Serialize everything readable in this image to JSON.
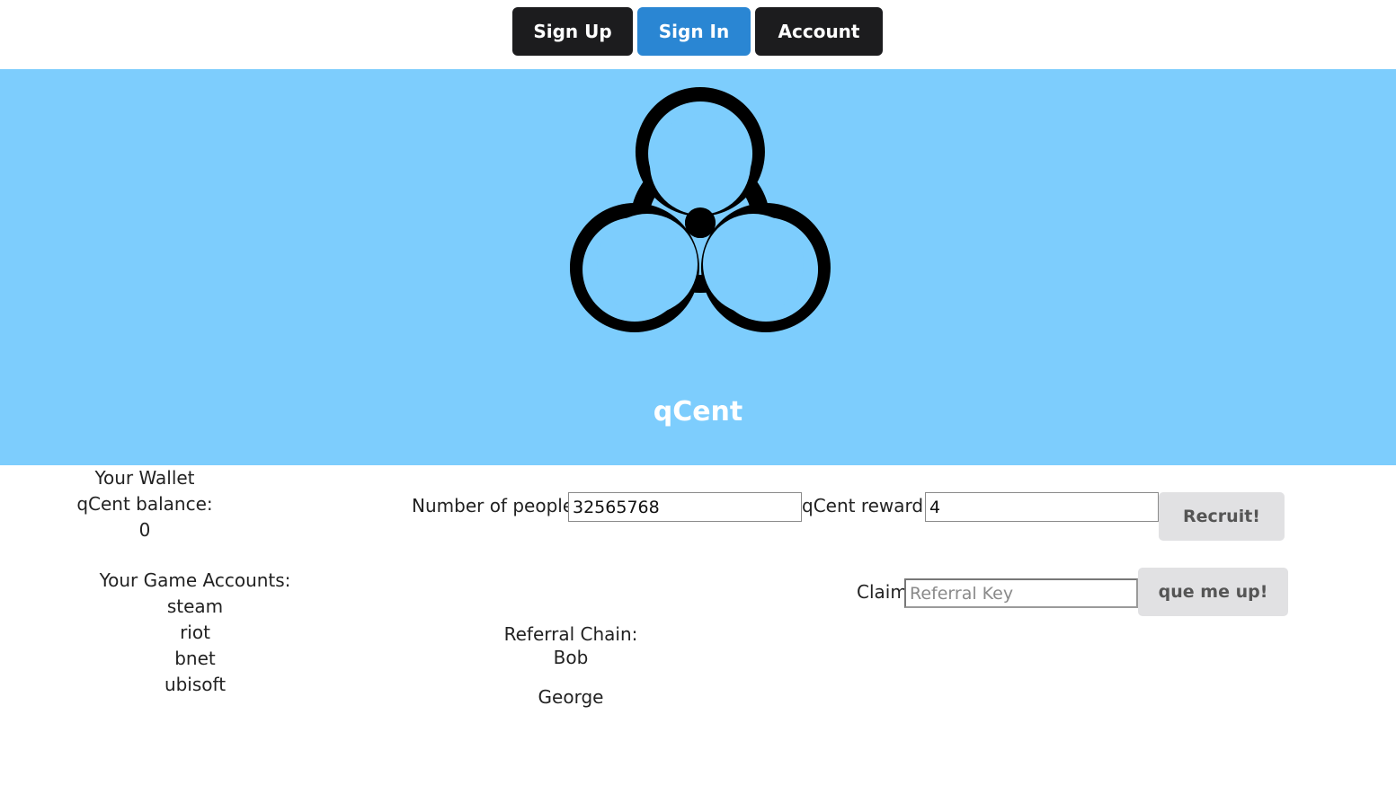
{
  "nav": {
    "signup_label": "Sign Up",
    "signin_label": "Sign In",
    "account_label": "Account"
  },
  "hero": {
    "icon": "biohazard-icon",
    "title": "qCent",
    "background": "#7dcdfd"
  },
  "wallet": {
    "title": "Your Wallet",
    "balance_label": "qCent balance:",
    "balance_value": "0"
  },
  "game_accounts": {
    "title": "Your Game Accounts:",
    "items": [
      "steam",
      "riot",
      "bnet",
      "ubisoft"
    ]
  },
  "recruit": {
    "people_label": "Number of people:",
    "people_value": "32565768",
    "reward_label": "qCent reward:",
    "reward_value": "4",
    "button_label": "Recruit!"
  },
  "claim": {
    "label": "Claim",
    "placeholder": "Referral Key",
    "button_label": "que me up!"
  },
  "referral_chain": {
    "title": "Referral Chain:",
    "items": [
      "Bob",
      "George"
    ]
  },
  "colors": {
    "signin_accent": "#2a86d3",
    "dark_button": "#1c1c1e"
  }
}
